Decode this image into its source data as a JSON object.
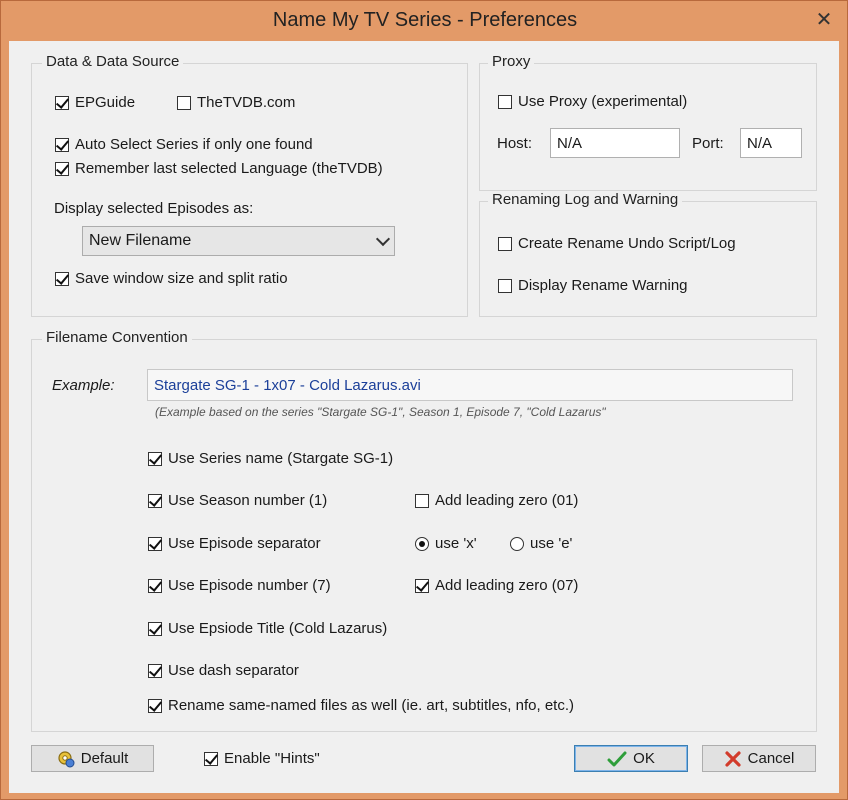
{
  "window": {
    "title": "Name My TV Series - Preferences",
    "close_glyph": "✕"
  },
  "data_source": {
    "title": "Data & Data Source",
    "epguide": {
      "label": "EPGuide",
      "checked": true
    },
    "thetvdb": {
      "label": "TheTVDB.com",
      "checked": false
    },
    "auto_select": {
      "label": "Auto Select Series if only one found",
      "checked": true
    },
    "remember_lang": {
      "label": "Remember last selected Language (theTVDB)",
      "checked": true
    },
    "display_label": "Display selected Episodes as:",
    "display_value": "New Filename",
    "save_window": {
      "label": "Save window size and split ratio",
      "checked": true
    }
  },
  "proxy": {
    "title": "Proxy",
    "use_proxy": {
      "label": "Use Proxy (experimental)",
      "checked": false
    },
    "host_label": "Host:",
    "host_value": "N/A",
    "port_label": "Port:",
    "port_value": "N/A"
  },
  "renaming": {
    "title": "Renaming Log and Warning",
    "undo_script": {
      "label": "Create Rename Undo Script/Log",
      "checked": false
    },
    "rename_warning": {
      "label": "Display Rename Warning",
      "checked": false
    }
  },
  "filename": {
    "title": "Filename Convention",
    "example_label": "Example:",
    "example_value": "Stargate SG-1 - 1x07 - Cold Lazarus.avi",
    "example_hint": "(Example based on the series \"Stargate SG-1\", Season 1, Episode 7, \"Cold Lazarus\"",
    "series_name": {
      "label": "Use Series name (Stargate SG-1)",
      "checked": true
    },
    "season_number": {
      "label": "Use Season number (1)",
      "checked": true
    },
    "season_zero": {
      "label": "Add leading zero (01)",
      "checked": false
    },
    "episode_sep": {
      "label": "Use Episode separator",
      "checked": true
    },
    "use_x": {
      "label": "use 'x'",
      "selected": true
    },
    "use_e": {
      "label": "use 'e'",
      "selected": false
    },
    "episode_number": {
      "label": "Use Episode number (7)",
      "checked": true
    },
    "episode_zero": {
      "label": "Add leading zero (07)",
      "checked": true
    },
    "episode_title": {
      "label": "Use Epsiode Title (Cold Lazarus)",
      "checked": true
    },
    "dash_sep": {
      "label": "Use dash separator",
      "checked": true
    },
    "same_named": {
      "label": "Rename same-named files as well (ie. art, subtitles, nfo, etc.)",
      "checked": true
    }
  },
  "footer": {
    "default_label": "Default",
    "hints": {
      "label": "Enable \"Hints\"",
      "checked": true
    },
    "ok_label": "OK",
    "cancel_label": "Cancel"
  },
  "colors": {
    "title_bar": "#e39a68",
    "client_bg": "#f0f0f0",
    "example_text": "#1b3f99",
    "ok_check": "#2e9e3a",
    "cancel_x": "#d23b2b"
  }
}
